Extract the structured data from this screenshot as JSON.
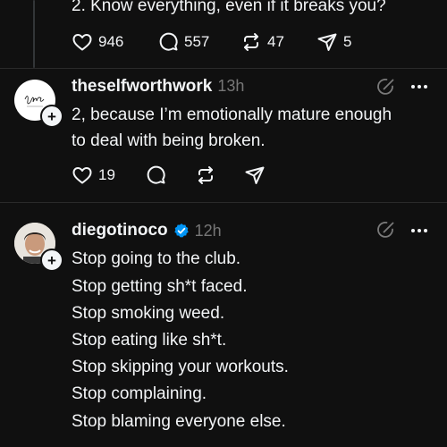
{
  "post1": {
    "text": "2. Know everything, even if it breaks you?",
    "likes": "946",
    "replies": "557",
    "reposts": "47",
    "shares": "5"
  },
  "post2": {
    "username": "theselfworthwork",
    "time": "13h",
    "lines": [
      "2, because I’m emotionally mature enough",
      "to deal with being broken."
    ],
    "likes": "19"
  },
  "post3": {
    "username": "diegotinoco",
    "time": "12h",
    "verified_color": "#0095f6",
    "lines": [
      "Stop going to the club.",
      "Stop getting sh*t faced.",
      "Stop smoking weed.",
      "Stop eating like sh*t.",
      "Stop skipping your workouts.",
      "Stop complaining.",
      "Stop blaming everyone else."
    ]
  },
  "icons": {
    "like": "heart-icon",
    "reply": "comment-icon",
    "repost": "repost-icon",
    "share": "send-icon",
    "more": "more-icon",
    "edit": "edit-icon",
    "follow": "plus-icon"
  }
}
